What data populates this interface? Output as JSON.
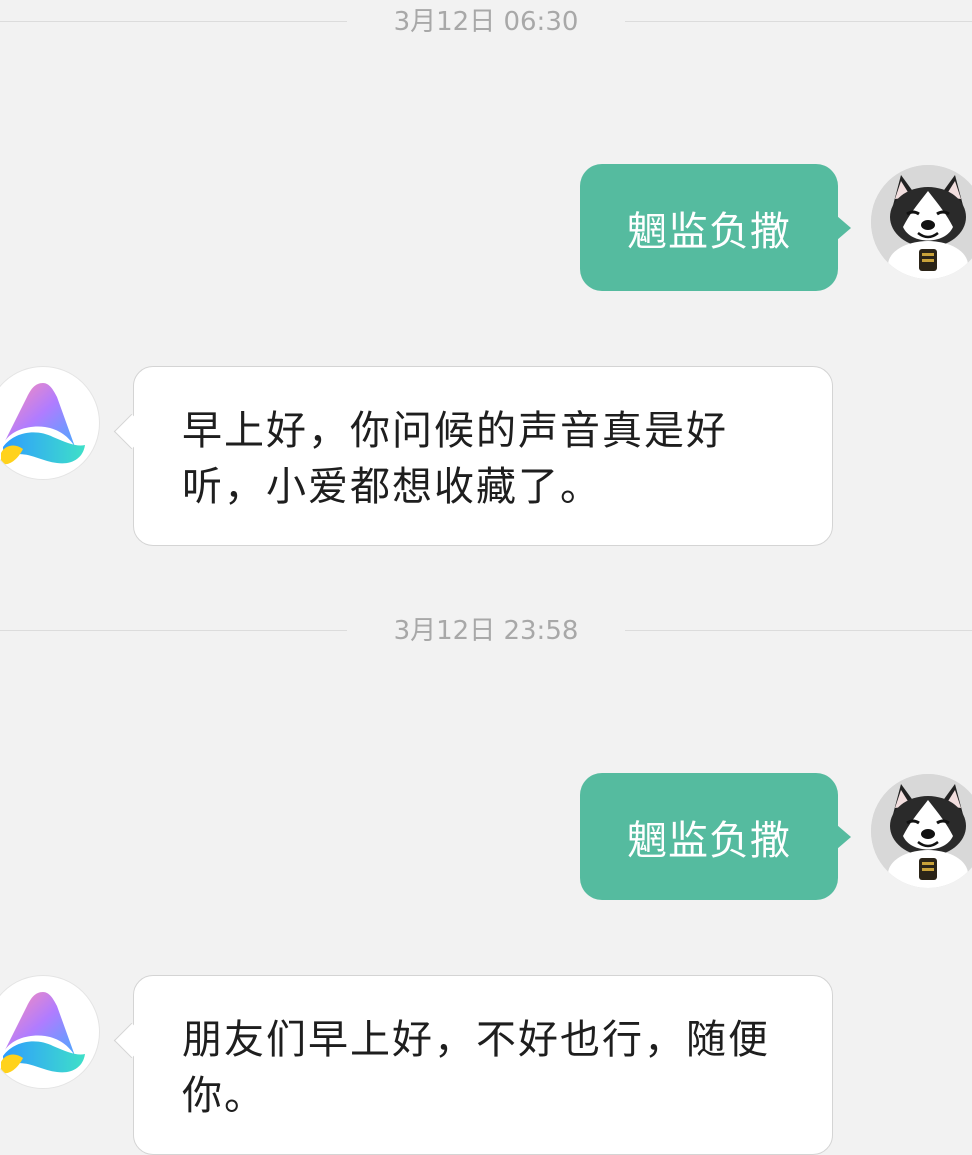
{
  "conversation": [
    {
      "timestamp": "3月12日 06:30",
      "user_message": "魍监负撒",
      "bot_reply": [
        "早上好，你问候的声音真是好",
        "听，小爱都想收藏了。"
      ]
    },
    {
      "timestamp": "3月12日 23:58",
      "user_message": "魍监负撒",
      "bot_reply": [
        "朋友们早上好，不好也行，随便",
        "你。"
      ]
    }
  ],
  "colors": {
    "background": "#f2f2f2",
    "user_bubble": "#55bb9f",
    "bot_bubble": "#ffffff",
    "timestamp_text": "#a8a8a8"
  },
  "icons": {
    "user_avatar": "husky-dog-avatar",
    "bot_avatar": "xiaoai-logo-avatar"
  }
}
